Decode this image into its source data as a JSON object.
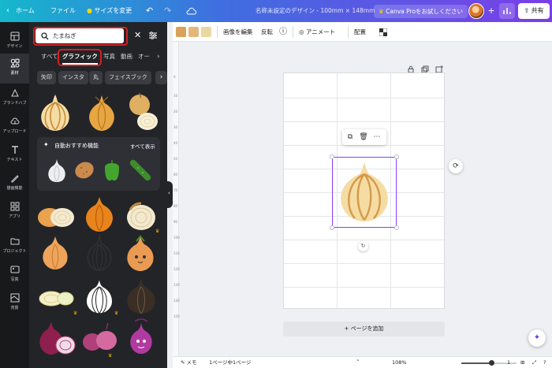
{
  "topbar": {
    "home": "ホーム",
    "file": "ファイル",
    "resize": "サイズを変更",
    "doc_title": "名称未設定のデザイン - 100mm × 148mm",
    "canva_pro": "Canva Proをお試しください",
    "share": "共有"
  },
  "rail": [
    {
      "label": "デザイン",
      "icon": "layout-icon"
    },
    {
      "label": "素材",
      "icon": "elements-icon"
    },
    {
      "label": "ブランドハブ",
      "icon": "brand-icon"
    },
    {
      "label": "アップロード",
      "icon": "upload-icon"
    },
    {
      "label": "テキスト",
      "icon": "text-icon"
    },
    {
      "label": "描画機能",
      "icon": "draw-icon"
    },
    {
      "label": "アプリ",
      "icon": "apps-icon"
    },
    {
      "label": "プロジェクト",
      "icon": "folder-icon"
    },
    {
      "label": "写真",
      "icon": "photo-icon"
    },
    {
      "label": "背景",
      "icon": "background-icon"
    }
  ],
  "panel": {
    "search_value": "たまねぎ",
    "tabs": [
      "すべて",
      "グラフィック",
      "写真",
      "動画",
      "オー"
    ],
    "active_tab": "グラフィック",
    "chips": [
      "矢印",
      "インスタ",
      "丸",
      "フェイスブック"
    ],
    "suggest_title": "自動おすすめ機能",
    "suggest_all": "すべて表示"
  },
  "toolbar": {
    "colors": [
      "#d9a25a",
      "#e3b77a",
      "#ecd6a2"
    ],
    "edit_image": "画像を編集",
    "flip": "反転",
    "animate": "アニメート",
    "position": "配置"
  },
  "ruler": [
    "0",
    "10",
    "20",
    "30",
    "40",
    "50",
    "60",
    "70",
    "80",
    "90",
    "100",
    "110",
    "120",
    "130",
    "140",
    "150"
  ],
  "canvas": {
    "add_page": "+ ページを追加"
  },
  "bottombar": {
    "memo": "メモ",
    "pages": "1ページ中1ページ",
    "zoom": "108%",
    "page_count": "1"
  },
  "zoom_fraction": 0.55
}
